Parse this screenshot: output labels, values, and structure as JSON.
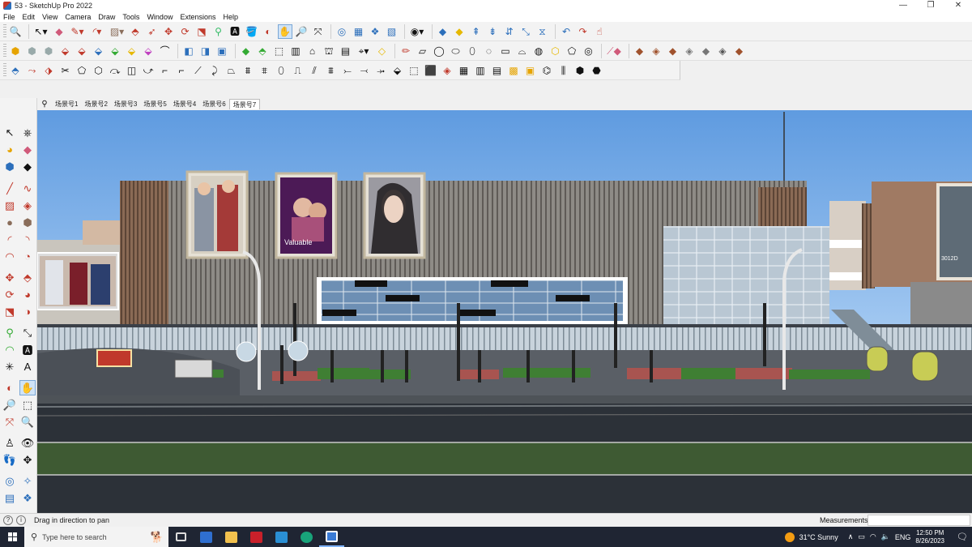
{
  "window": {
    "title": "53 - SketchUp Pro 2022",
    "minimize": "—",
    "maximize": "❐",
    "close": "✕"
  },
  "menu": [
    "File",
    "Edit",
    "View",
    "Camera",
    "Draw",
    "Tools",
    "Window",
    "Extensions",
    "Help"
  ],
  "scenes": {
    "tabs": [
      "场景号1",
      "场景号2",
      "场景号3",
      "场景号5",
      "场景号4",
      "场景号6",
      "场景号7"
    ],
    "active_index": 6
  },
  "viewport": {
    "billboards": {
      "valuable_text": "Valuable",
      "sign_right_text": "3012D"
    }
  },
  "status": {
    "message": "Drag in direction to pan",
    "measurements_label": "Measurements",
    "measurements_value": ""
  },
  "taskbar": {
    "search_placeholder": "Type here to search",
    "weather": "31°C  Sunny",
    "language": "ENG",
    "time": "12:50 PM",
    "date": "8/26/2023"
  },
  "colors": {
    "sky": "#6fa6e4",
    "facade": "#8e8b86",
    "road": "#2c3138",
    "grass_strip": "#3e5a33",
    "accent_selection": "#cfe3f7"
  }
}
